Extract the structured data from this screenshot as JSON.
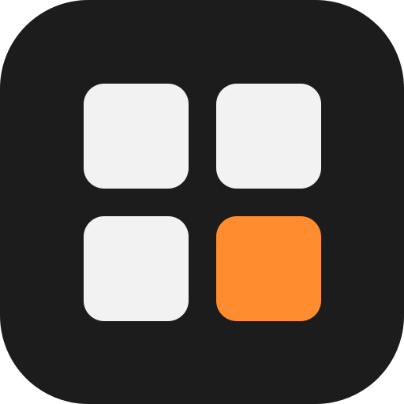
{
  "icon": {
    "name": "four-tile-grid-icon",
    "background_color": "#1c1c1c",
    "tile_color": "#f2f2f2",
    "accent_tile_color": "#ff8c2e",
    "tiles": [
      {
        "position": "top-left",
        "accent": false
      },
      {
        "position": "top-right",
        "accent": false
      },
      {
        "position": "bottom-left",
        "accent": false
      },
      {
        "position": "bottom-right",
        "accent": true
      }
    ]
  }
}
